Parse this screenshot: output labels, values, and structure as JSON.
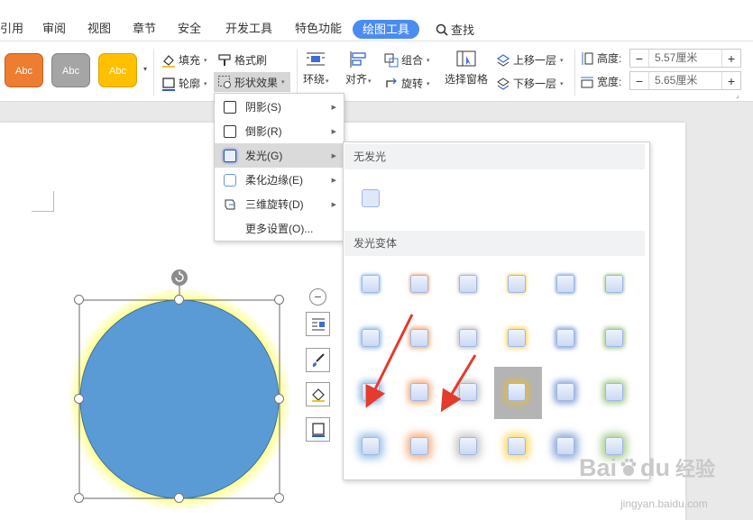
{
  "tabs": {
    "items": [
      "引用",
      "审阅",
      "视图",
      "章节",
      "安全",
      "开发工具",
      "特色功能"
    ],
    "active": "绘图工具",
    "search": "查找"
  },
  "styles": [
    {
      "label": "Abc",
      "color": "#ed7d31"
    },
    {
      "label": "Abc",
      "color": "#a5a5a5"
    },
    {
      "label": "Abc",
      "color": "#ffc000"
    }
  ],
  "ribbon": {
    "fill": "填充",
    "format_painter": "格式刷",
    "outline": "轮廓",
    "shape_effects": "形状效果",
    "wrap": "环绕",
    "align": "对齐",
    "group": "组合",
    "rotate": "旋转",
    "selection_pane": "选择窗格",
    "bring_forward": "上移一层",
    "send_backward": "下移一层",
    "height_label": "高度:",
    "height_value": "5.57厘米",
    "width_label": "宽度:",
    "width_value": "5.65厘米"
  },
  "menu": {
    "items": [
      "阴影(S)",
      "倒影(R)",
      "发光(G)",
      "柔化边缘(E)",
      "三维旋转(D)",
      "更多设置(O)..."
    ],
    "highlighted": "发光(G)"
  },
  "submenu": {
    "no_glow_header": "无发光",
    "variants_header": "发光变体",
    "glow_colors": [
      "#5b9bd5",
      "#ed7d31",
      "#a5a5a5",
      "#ffc000",
      "#4472c4",
      "#70ad47"
    ]
  },
  "shape": {
    "fill": "#5b9bd5",
    "glow": "#ffff66"
  },
  "watermark": {
    "brand_left": "Bai",
    "brand_right": "du",
    "brand_cn": "经验",
    "url": "jingyan.baidu.com"
  }
}
